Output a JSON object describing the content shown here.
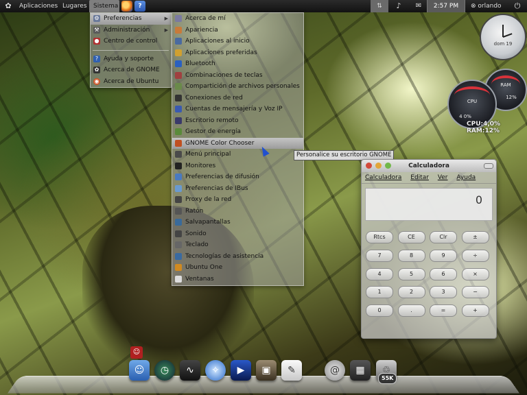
{
  "top_panel": {
    "applications": "Aplicaciones",
    "places": "Lugares",
    "system": "Sistema",
    "clock": "2:57 PM",
    "user": "orlando",
    "icons": {
      "foot": "gnome-foot-icon",
      "firefox": "firefox-icon",
      "help": "help-icon",
      "network": "network-icon",
      "volume": "volume-icon",
      "mail": "mail-icon",
      "user": "user-switch-icon",
      "power": "power-icon"
    }
  },
  "system_menu": {
    "items": [
      {
        "label": "Preferencias",
        "icon": "preferences-icon",
        "submenu": true,
        "highlighted": true
      },
      {
        "label": "Administración",
        "icon": "admin-icon",
        "submenu": true
      },
      {
        "label": "Centro de control",
        "icon": "control-center-icon"
      }
    ],
    "items_after_separator": [
      {
        "label": "Ayuda y soporte",
        "icon": "help-icon"
      },
      {
        "label": "Acerca de GNOME",
        "icon": "gnome-icon"
      },
      {
        "label": "Acerca de Ubuntu",
        "icon": "ubuntu-icon"
      }
    ]
  },
  "preferences_menu": {
    "items": [
      "Acerca de mí",
      "Apariencia",
      "Aplicaciones al inicio",
      "Aplicaciones preferidas",
      "Bluetooth",
      "Combinaciones de teclas",
      "Compartición de archivos personales",
      "Conexiones de red",
      "Cuentas de mensajería y Voz IP",
      "Escritorio remoto",
      "Gestor de energía",
      "GNOME Color Chooser",
      "Menú principal",
      "Monitores",
      "Preferencias de difusión",
      "Preferencias de IBus",
      "Proxy de la red",
      "Ratón",
      "Salvapantallas",
      "Sonido",
      "Teclado",
      "Tecnologías de asistencia",
      "Ubuntu One",
      "Ventanas"
    ],
    "highlighted_index": 11
  },
  "tooltip": "Personalice su escritorio GNOME",
  "calculator": {
    "title": "Calculadora",
    "menu": [
      "Calculadora",
      "Editar",
      "Ver",
      "Ayuda"
    ],
    "display": "0",
    "keys": [
      [
        "Rtcs",
        "CE",
        "Clr",
        "±"
      ],
      [
        "7",
        "8",
        "9",
        "÷"
      ],
      [
        "4",
        "5",
        "6",
        "×"
      ],
      [
        "1",
        "2",
        "3",
        "−"
      ],
      [
        "0",
        ".",
        "=",
        "+"
      ]
    ]
  },
  "desklets": {
    "clock_label": "dom 19",
    "cpu_gauge_label": "CPU",
    "cpu_gauge_value": "4  0%",
    "ram_gauge_label": "RAM",
    "ram_gauge_value": "12%",
    "cpu_text": "CPU:4,0%",
    "ram_text": "RAM:12%"
  },
  "dock": {
    "badge": "55K",
    "icons": [
      "finder-icon",
      "time-machine-icon",
      "activity-monitor-icon",
      "safari-icon",
      "clapper-icon",
      "photo-icon",
      "textedit-icon",
      "mail-at-icon",
      "pictures-icon",
      "trash-icon"
    ]
  },
  "colors": {
    "panel_bg": "#1a1a1a",
    "menu_bg": "#a0a0a0",
    "highlight": "#b0b0b0",
    "gauge_red": "#d8323a"
  }
}
